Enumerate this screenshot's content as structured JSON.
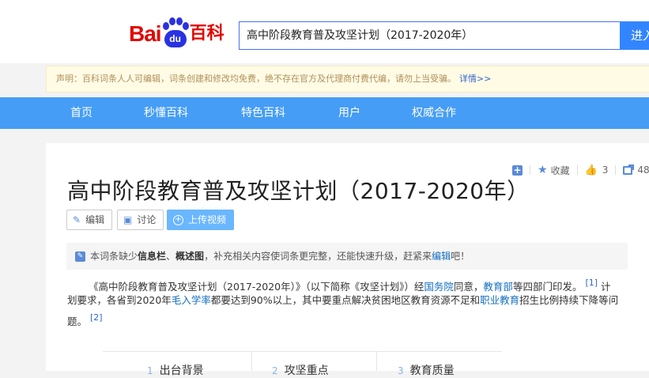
{
  "header": {
    "logo_left": "Bai",
    "logo_paw": "du",
    "logo_right": "百科",
    "search_value": "高中阶段教育普及攻坚计划（2017-2020年）",
    "search_button": "进入"
  },
  "notice": {
    "text": "声明：百科词条人人可编辑，词条创建和修改均免费，绝不存在官方及代理商付费代编，请勿上当受骗。",
    "more": "详情>>"
  },
  "nav": [
    "首页",
    "秒懂百科",
    "特色百科",
    "用户",
    "权威合作"
  ],
  "toolbar": {
    "favorite": "收藏",
    "likes": "3",
    "shares": "48"
  },
  "title": "高中阶段教育普及攻坚计划（2017-2020年）",
  "actions": {
    "edit": "编辑",
    "discuss": "讨论",
    "upload": "上传视频"
  },
  "tip": {
    "pre": "本词条缺少",
    "b1": "信息栏",
    "sep": "、",
    "b2": "概述图",
    "mid": "，补充相关内容使词条更完整，还能快速升级，赶紧来",
    "link": "编辑",
    "post": "吧！"
  },
  "para": {
    "l1_a": "《高中阶段教育普及攻坚计划（2017-2020年）》（以下简称《攻坚计划》）经",
    "l1_link1": "国务院",
    "l1_b": "同意，",
    "l1_link2": "教育部",
    "l1_c": "等四部门印发。",
    "ref1": "[1]",
    "l1_d": " 计",
    "l2_a": "划要求，各省到2020年",
    "l2_link1": "毛入学率",
    "l2_b": "都要达到90%以上，其中要重点解决贫困地区教育资源不足和",
    "l2_link2": "职业教育",
    "l2_c": "招生比例持续下降等问",
    "l3_a": "题。",
    "ref2": "[2]"
  },
  "toc": [
    {
      "num": "1",
      "label": "出台背景"
    },
    {
      "num": "2",
      "label": "攻坚重点"
    },
    {
      "num": "3",
      "label": "教育质量"
    }
  ]
}
